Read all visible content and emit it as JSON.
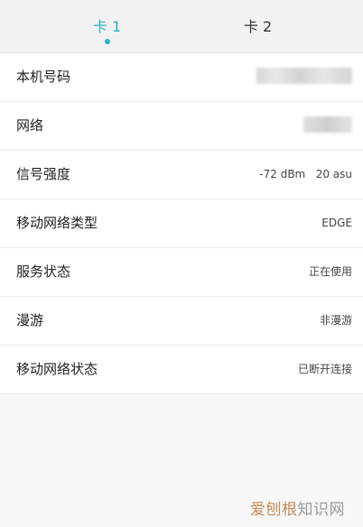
{
  "tabs": [
    {
      "label": "卡 1",
      "active": true
    },
    {
      "label": "卡 2",
      "active": false
    }
  ],
  "colors": {
    "accent": "#2cb3c6",
    "background": "#f7f7f7",
    "row_background": "#ffffff",
    "watermark_brand": "#c58a5a"
  },
  "rows": [
    {
      "label": "本机号码",
      "value": ""
    },
    {
      "label": "网络",
      "value": ""
    },
    {
      "label": "信号强度",
      "value": "-72 dBm   20 asu"
    },
    {
      "label": "移动网络类型",
      "value": "EDGE"
    },
    {
      "label": "服务状态",
      "value": "正在使用"
    },
    {
      "label": "漫游",
      "value": "非漫游"
    },
    {
      "label": "移动网络状态",
      "value": "已断开连接"
    }
  ],
  "watermark": {
    "brand": "爱刨根",
    "rest": "知识网"
  }
}
